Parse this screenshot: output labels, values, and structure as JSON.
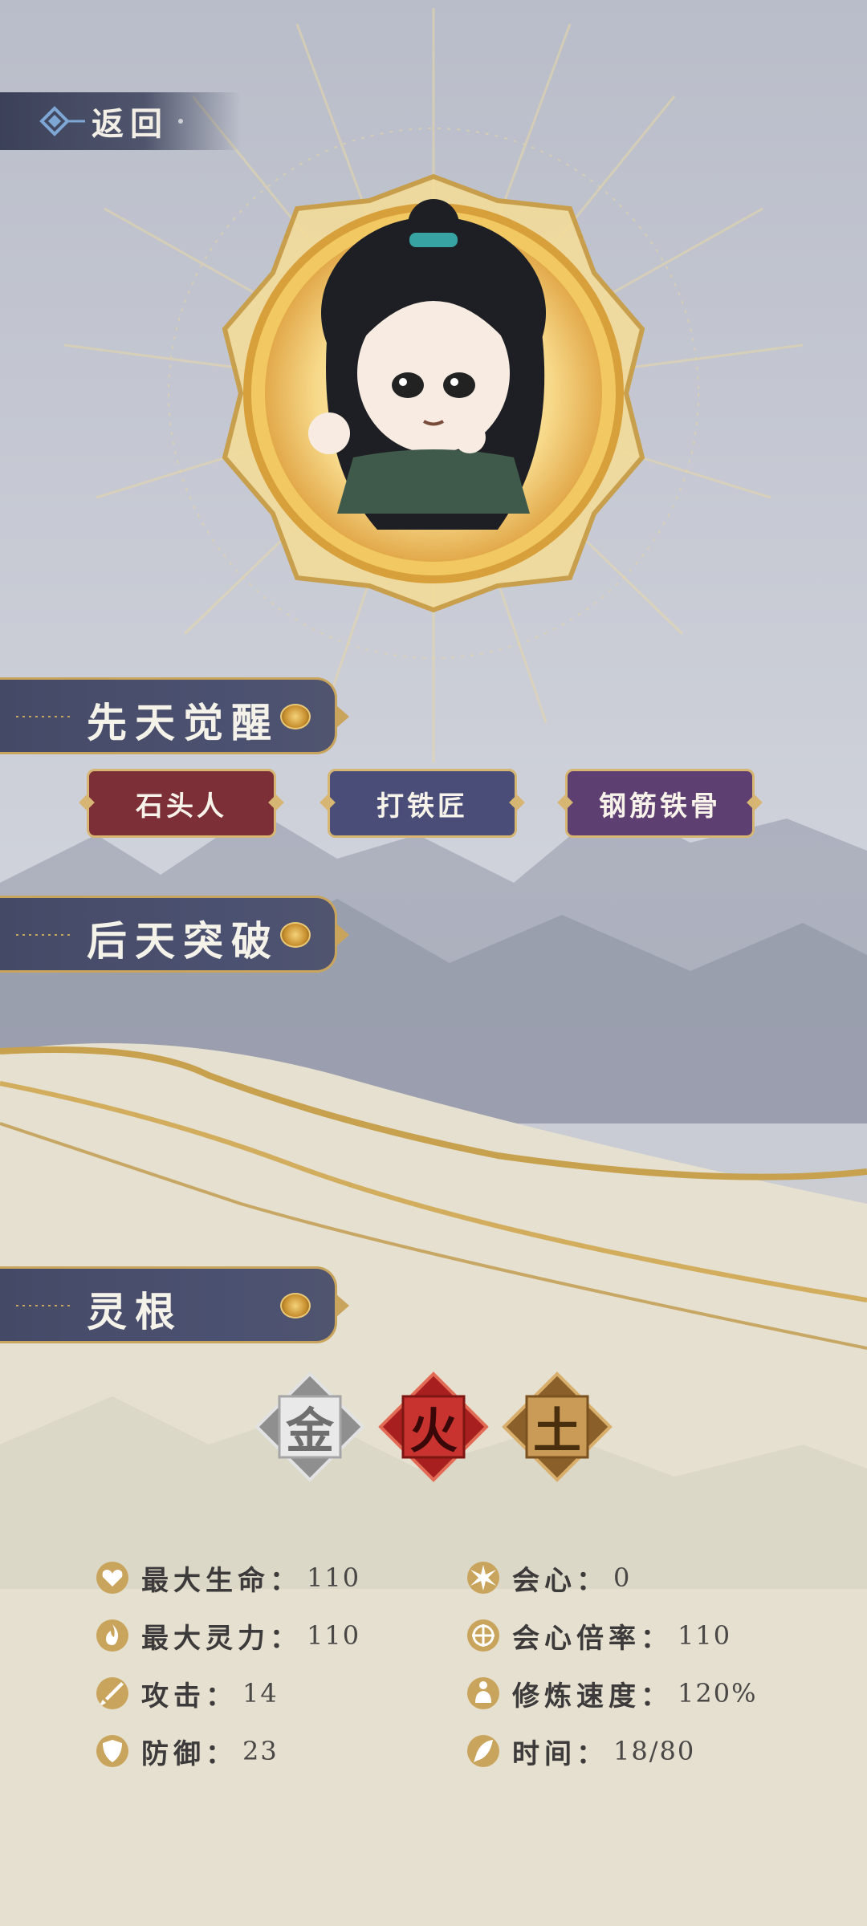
{
  "topbar": {
    "back_label": "返回"
  },
  "sections": {
    "innate": "先天觉醒",
    "acquired": "后天突破",
    "spirit_root": "灵根"
  },
  "innate_tags": [
    {
      "label": "石头人",
      "color": "#7d2f37"
    },
    {
      "label": "打铁匠",
      "color": "#4a4d78"
    },
    {
      "label": "钢筋铁骨",
      "color": "#5e3f72"
    }
  ],
  "elements": [
    {
      "char": "金",
      "icon": "metal-element-icon",
      "color": "#9a9a9a"
    },
    {
      "char": "火",
      "icon": "fire-element-icon",
      "color": "#c8322f"
    },
    {
      "char": "土",
      "icon": "earth-element-icon",
      "color": "#a97b3e"
    }
  ],
  "stats": {
    "max_hp": {
      "label": "最大生命：",
      "value": "110",
      "icon": "heart-icon"
    },
    "max_mana": {
      "label": "最大灵力：",
      "value": "110",
      "icon": "flame-icon"
    },
    "attack": {
      "label": "攻击：",
      "value": "14",
      "icon": "sword-icon"
    },
    "defense": {
      "label": "防御：",
      "value": "23",
      "icon": "shield-icon"
    },
    "crit": {
      "label": "会心：",
      "value": "0",
      "icon": "burst-icon"
    },
    "crit_multiplier": {
      "label": "会心倍率：",
      "value": "110",
      "icon": "crosshair-icon"
    },
    "cultivation_speed": {
      "label": "修炼速度：",
      "value": "120%",
      "icon": "meditation-icon"
    },
    "time": {
      "label": "时间：",
      "value": "18/80",
      "icon": "feather-icon"
    }
  },
  "colors": {
    "gold": "#c9a45c",
    "panel": "#474c6a"
  }
}
